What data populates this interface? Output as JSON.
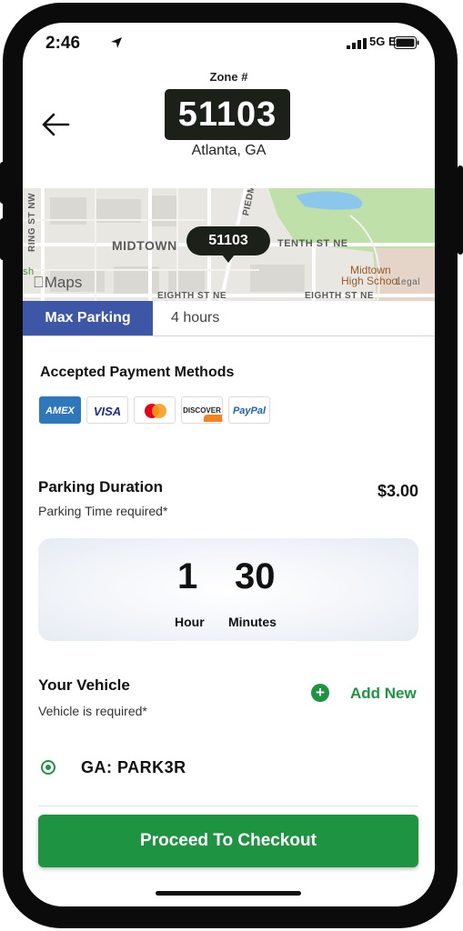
{
  "status_bar": {
    "time": "2:46",
    "network": "5G E"
  },
  "header": {
    "zone_label": "Zone #",
    "zone_number": "51103",
    "city": "Atlanta, GA"
  },
  "map": {
    "pin_label": "51103",
    "labels": {
      "midtown": "MIDTOWN",
      "tenth_st": "TENTH ST NE",
      "piedmont": "PIEDM",
      "spring_st": "RING ST NW",
      "high_school": [
        "Midtown",
        "High School"
      ],
      "legal": "Legal",
      "eighth_st_1": "EIGHTH ST NE",
      "eighth_st_2": "EIGHTH ST NE",
      "edge": "sh"
    },
    "logo_text": "Maps"
  },
  "tabs": {
    "max_parking": "Max Parking",
    "hours": "4 hours"
  },
  "payment": {
    "title": "Accepted Payment Methods",
    "cards": [
      "AMEX",
      "VISA",
      "Mastercard",
      "DISCOVER",
      "PayPal"
    ]
  },
  "duration": {
    "title": "Parking Duration",
    "required": "Parking Time required*",
    "price": "$3.00",
    "hours_value": "1",
    "hours_label": "Hour",
    "minutes_value": "30",
    "minutes_label": "Minutes"
  },
  "vehicle": {
    "title": "Your Vehicle",
    "required": "Vehicle is required*",
    "add_label": "Add New",
    "selected_plate": "GA: PARK3R"
  },
  "checkout_label": "Proceed To Checkout",
  "colors": {
    "brand_green": "#1e9443",
    "tab_blue": "#3d56a5",
    "zone_dark": "#1b2018"
  }
}
